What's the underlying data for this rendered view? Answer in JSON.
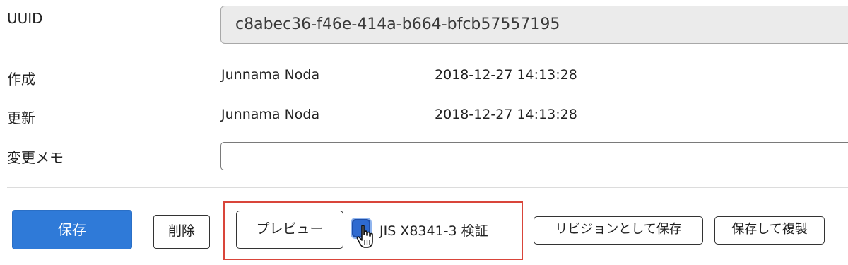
{
  "uuid": {
    "label": "UUID",
    "value": "c8abec36-f46e-414a-b664-bfcb57557195"
  },
  "created": {
    "label": "作成",
    "user": "Junnama Noda",
    "datetime": "2018-12-27 14:13:28"
  },
  "updated": {
    "label": "更新",
    "user": "Junnama Noda",
    "datetime": "2018-12-27 14:13:28"
  },
  "memo": {
    "label": "変更メモ",
    "value": "",
    "placeholder": ""
  },
  "actions": {
    "save": "保存",
    "delete": "削除",
    "preview": "プレビュー",
    "jis_check_label": "JIS X8341-3 検証",
    "jis_check_checked": true,
    "save_as_revision": "リビジョンとして保存",
    "save_and_duplicate": "保存して複製"
  },
  "colors": {
    "primary": "#2f7ad8",
    "highlight": "#d9453a",
    "checkbox": "#2e6ad0"
  }
}
